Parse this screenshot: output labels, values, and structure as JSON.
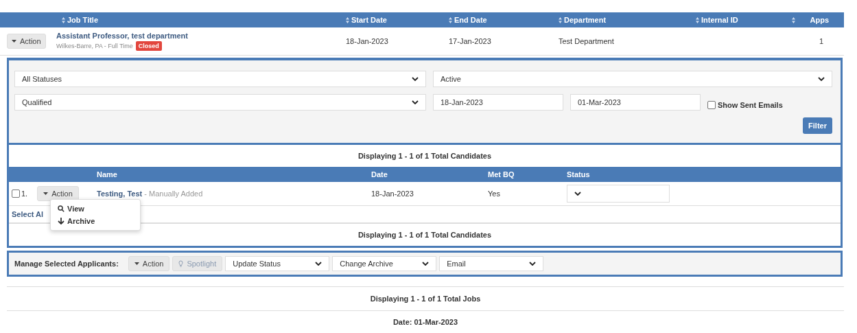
{
  "jobs_table": {
    "columns": [
      {
        "label": "Job Title"
      },
      {
        "label": "Start Date"
      },
      {
        "label": "End Date"
      },
      {
        "label": "Department"
      },
      {
        "label": "Internal ID"
      },
      {
        "label": "Apps"
      }
    ],
    "rows": [
      {
        "action": "Action",
        "title": "Assistant Professor, test department",
        "location": "Wilkes-Barre, PA - Full Time",
        "badge": "Closed",
        "start": "18-Jan-2023",
        "end": "17-Jan-2023",
        "department": "Test Department",
        "apps": "1"
      }
    ]
  },
  "filters": {
    "row_1": [
      {
        "kind": "select",
        "value": "All Statuses"
      },
      {
        "kind": "select",
        "value": "Active"
      }
    ],
    "row_2": [
      {
        "kind": "select",
        "value": "Qualified"
      },
      {
        "kind": "date",
        "value": "18-Jan-2023"
      },
      {
        "kind": "date",
        "value": "01-Mar-2023"
      },
      {
        "kind": "checkbox",
        "label": "Show Sent Emails",
        "checked": false
      }
    ],
    "button": "Filter"
  },
  "candidates": {
    "summary_top": "Displaying 1 - 1 of 1 Total Candidates",
    "columns": [
      "Name",
      "Date",
      "Met BQ",
      "Status"
    ],
    "rows": [
      {
        "number": "1.",
        "checked": false,
        "action": "Action",
        "name": "Testing, Test",
        "source": " - Manually Added",
        "date": "18-Jan-2023",
        "met_bq": "Yes"
      }
    ],
    "select_all": "Select Al",
    "summary_bottom": "Displaying 1 - 1 of 1 Total Candidates"
  },
  "action_menu": [
    {
      "kind": "view",
      "label": "View"
    },
    {
      "kind": "archive",
      "label": "Archive"
    }
  ],
  "manage": {
    "label": "Manage Selected Applicants:",
    "action": "Action",
    "spotlight": "Spotlight",
    "selects": [
      "Update Status",
      "Change Archive",
      "Email"
    ]
  },
  "jobs_summary": "Displaying 1 - 1 of 1 Total Jobs",
  "date_line": "Date: 01-Mar-2023"
}
